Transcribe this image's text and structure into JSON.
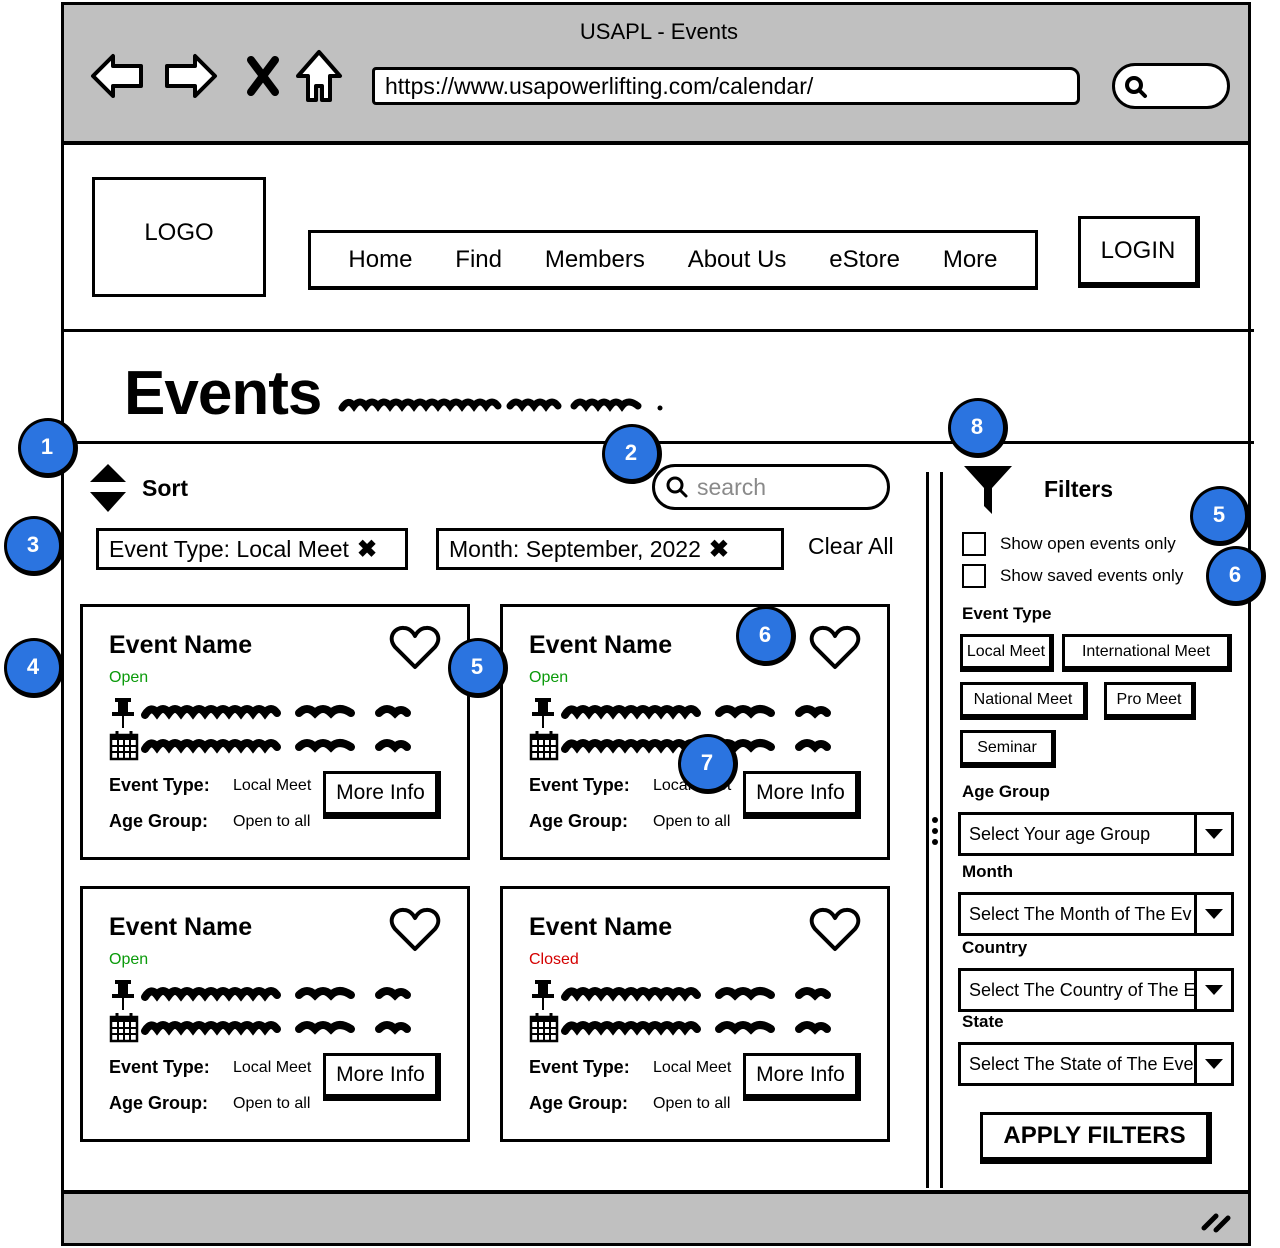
{
  "browser": {
    "window_title": "USAPL - Events",
    "url": "https://www.usapowerlifting.com/calendar/",
    "icons": [
      "back-arrow-icon",
      "forward-arrow-icon",
      "close-icon",
      "home-icon",
      "search-icon"
    ]
  },
  "header": {
    "logo": "LOGO",
    "nav": [
      "Home",
      "Find",
      "Members",
      "About Us",
      "eStore",
      "More"
    ],
    "login_label": "LOGIN"
  },
  "page": {
    "title": "Events"
  },
  "toolbar": {
    "sort_label": "Sort",
    "search_placeholder": "search",
    "active_filters": [
      {
        "label": "Event Type: Local Meet",
        "remove_icon": "x-icon"
      },
      {
        "label": "Month: September, 2022",
        "remove_icon": "x-icon"
      }
    ],
    "clear_all_label": "Clear All"
  },
  "events": [
    {
      "name": "Event Name",
      "status": "Open",
      "event_type_label": "Event Type:",
      "event_type": "Local Meet",
      "age_group_label": "Age Group:",
      "age_group": "Open to all",
      "more_info_label": "More Info"
    },
    {
      "name": "Event Name",
      "status": "Open",
      "event_type_label": "Event Type:",
      "event_type": "Local Meet",
      "age_group_label": "Age Group:",
      "age_group": "Open to all",
      "more_info_label": "More Info"
    },
    {
      "name": "Event Name",
      "status": "Open",
      "event_type_label": "Event Type:",
      "event_type": "Local Meet",
      "age_group_label": "Age Group:",
      "age_group": "Open to all",
      "more_info_label": "More Info"
    },
    {
      "name": "Event Name",
      "status": "Closed",
      "event_type_label": "Event Type:",
      "event_type": "Local Meet",
      "age_group_label": "Age Group:",
      "age_group": "Open to all",
      "more_info_label": "More Info"
    }
  ],
  "status_colors": {
    "open": "#0a9a0a",
    "closed": "#d40000"
  },
  "filters": {
    "title": "Filters",
    "checkboxes": [
      {
        "label": "Show open events only",
        "checked": false
      },
      {
        "label": "Show saved events only",
        "checked": false
      }
    ],
    "event_type_label": "Event Type",
    "event_types": [
      "Local Meet",
      "International Meet",
      "National Meet",
      "Pro Meet",
      "Seminar"
    ],
    "age_group_label": "Age Group",
    "age_group_placeholder": "Select Your age Group",
    "month_label": "Month",
    "month_placeholder": "Select The Month of The Ev",
    "country_label": "Country",
    "country_placeholder": "Select The Country of The E",
    "state_label": "State",
    "state_placeholder": "Select The State of The Eve",
    "apply_label": "APPLY FILTERS"
  },
  "annotations": {
    "accent": "#2b74e0",
    "markers": [
      "1",
      "2",
      "3",
      "4",
      "5",
      "6",
      "7",
      "8",
      "5",
      "6"
    ]
  }
}
